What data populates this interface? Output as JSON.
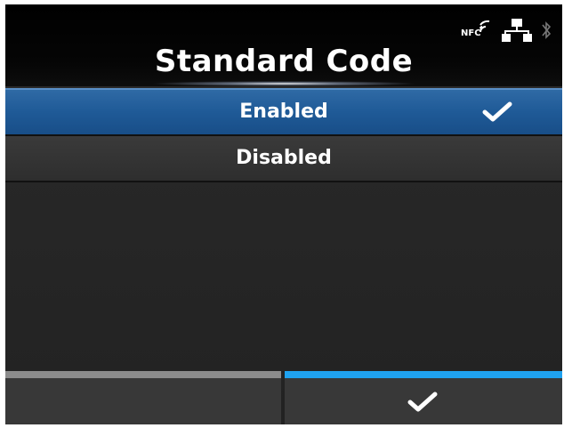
{
  "header": {
    "title": "Standard Code",
    "status": {
      "nfc_label": "NFC",
      "icons": [
        "nfc-icon",
        "network-icon",
        "bluetooth-icon"
      ]
    }
  },
  "options": [
    {
      "label": "Enabled",
      "selected": true
    },
    {
      "label": "Disabled",
      "selected": false
    }
  ],
  "softkeys": {
    "left": {
      "label": ""
    },
    "right": {
      "icon": "check-icon"
    }
  },
  "colors": {
    "selection": "#1f5a97",
    "confirm_bar": "#1fa2f0",
    "back_bar": "#8c8c8c"
  }
}
